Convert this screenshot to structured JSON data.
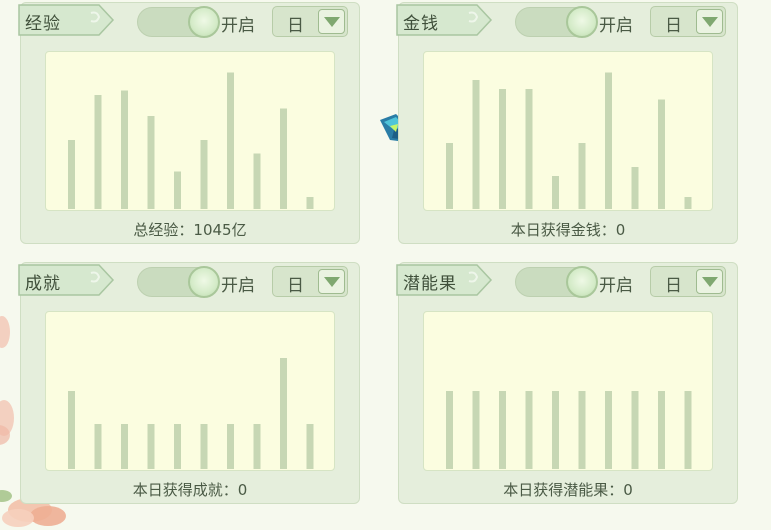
{
  "panels": [
    {
      "label": "经验",
      "toggle_text": "开启",
      "period": "日",
      "summary": "总经验：1045亿",
      "chart_data": {
        "type": "bar",
        "values": [
          46,
          76,
          79,
          62,
          25,
          46,
          91,
          37,
          67,
          8
        ],
        "ylim": [
          0,
          100
        ]
      }
    },
    {
      "label": "金钱",
      "toggle_text": "开启",
      "period": "日",
      "summary": "本日获得金钱：0",
      "chart_data": {
        "type": "bar",
        "values": [
          44,
          86,
          80,
          80,
          22,
          44,
          91,
          28,
          73,
          8
        ],
        "ylim": [
          0,
          100
        ]
      }
    },
    {
      "label": "成就",
      "toggle_text": "开启",
      "period": "日",
      "summary": "本日获得成就：0",
      "chart_data": {
        "type": "bar",
        "values": [
          52,
          30,
          30,
          30,
          30,
          30,
          30,
          30,
          74,
          30
        ],
        "ylim": [
          0,
          100
        ]
      }
    },
    {
      "label": "潜能果",
      "toggle_text": "开启",
      "period": "日",
      "summary": "本日获得潜能果：0",
      "chart_data": {
        "type": "bar",
        "values": [
          52,
          52,
          52,
          52,
          52,
          52,
          52,
          52,
          52,
          52
        ],
        "ylim": [
          0,
          100
        ]
      }
    }
  ],
  "colors": {
    "bar": "#c7d7b4",
    "panel_bg": "#e5eedc",
    "chart_bg": "#fbfde0"
  }
}
